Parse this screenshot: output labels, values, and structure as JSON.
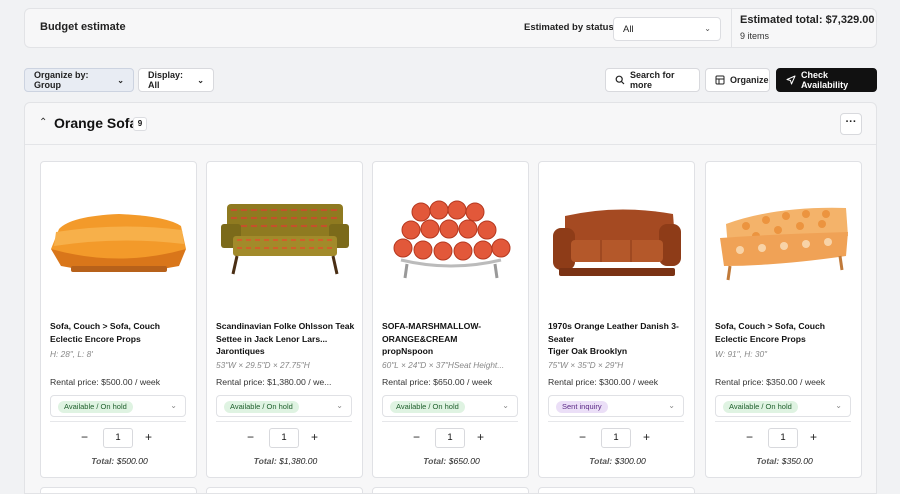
{
  "budget": {
    "title": "Budget estimate",
    "status_label": "Estimated by status:",
    "status_value": "All",
    "total": "Estimated total: $7,329.00",
    "items": "9 items"
  },
  "toolbar": {
    "organize_by": "Organize by: Group",
    "display": "Display: All",
    "search": "Search for more",
    "organize": "Organize",
    "check": "Check Availability"
  },
  "group": {
    "title": "Orange Sofa",
    "count": "9"
  },
  "cards": [
    {
      "title": "Sofa, Couch > Sofa, Couch",
      "vendor": "Eclectic Encore Props",
      "dims": "H: 28\", L: 8'",
      "price": "Rental price:  $500.00 / week",
      "status": "Available / On hold",
      "qty": "1",
      "total_label": "Total:",
      "total_value": "$500.00"
    },
    {
      "title": "Scandinavian Folke Ohlsson Teak Settee in Jack Lenor Lars...",
      "vendor": "Jarontiques",
      "dims": "53\"W × 29.5\"D × 27.75\"H",
      "price": "Rental price:  $1,380.00 / we...",
      "status": "Available / On hold",
      "qty": "1",
      "total_label": "Total:",
      "total_value": "$1,380.00"
    },
    {
      "title": "SOFA-MARSHMALLOW-ORANGE&CREAM",
      "vendor": "propNspoon",
      "dims": "60\"L × 24\"D × 37\"HSeat Height...",
      "price": "Rental price:  $650.00 / week",
      "status": "Available / On hold",
      "qty": "1",
      "total_label": "Total:",
      "total_value": "$650.00"
    },
    {
      "title": "1970s Orange Leather Danish 3-Seater",
      "vendor": "Tiger Oak Brooklyn",
      "dims": "75\"W × 35\"D × 29\"H",
      "price": "Rental price:  $300.00 / week",
      "status": "Sent inquiry",
      "qty": "1",
      "total_label": "Total:",
      "total_value": "$300.00"
    },
    {
      "title": "Sofa, Couch > Sofa, Couch",
      "vendor": "Eclectic Encore Props",
      "dims": "W: 91\", H: 30\"",
      "price": "Rental price:  $350.00 / week",
      "status": "Available / On hold",
      "qty": "1",
      "total_label": "Total:",
      "total_value": "$350.00"
    }
  ],
  "colors": {
    "available_bg": "#dff3e2",
    "inquiry_bg": "#ebdff7",
    "primary_button": "#111111"
  }
}
